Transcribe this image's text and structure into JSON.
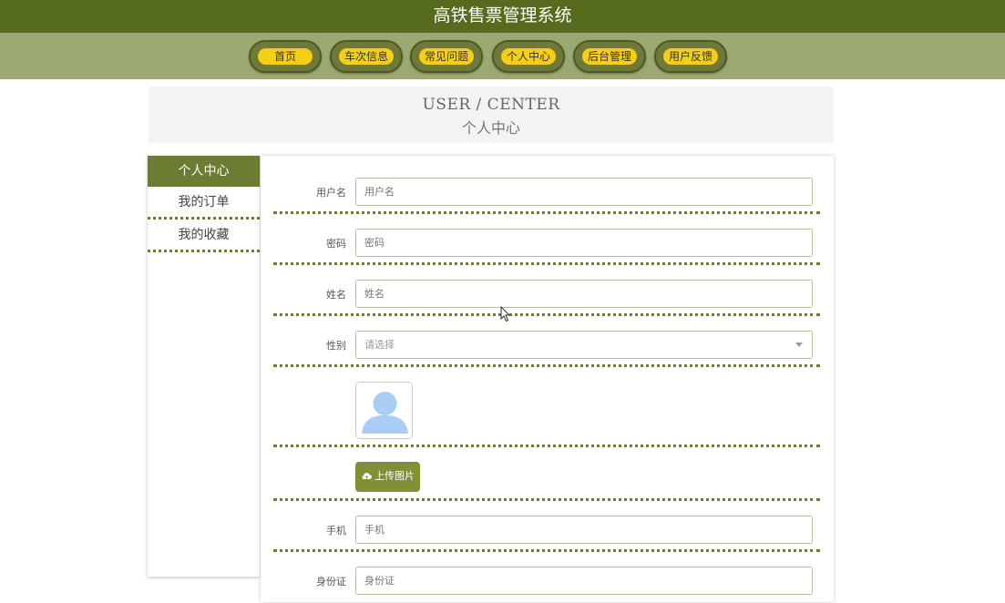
{
  "app": {
    "title": "高铁售票管理系统"
  },
  "nav": [
    {
      "label": "首页"
    },
    {
      "label": "车次信息"
    },
    {
      "label": "常见问题"
    },
    {
      "label": "个人中心"
    },
    {
      "label": "后台管理"
    },
    {
      "label": "用户反馈"
    }
  ],
  "banner": {
    "en": "USER / CENTER",
    "cn": "个人中心"
  },
  "sidebar": {
    "title": "个人中心",
    "items": [
      {
        "label": "我的订单"
      },
      {
        "label": "我的收藏"
      }
    ]
  },
  "form": {
    "username": {
      "label": "用户名",
      "placeholder": "用户名"
    },
    "password": {
      "label": "密码",
      "placeholder": "密码"
    },
    "name": {
      "label": "姓名",
      "placeholder": "姓名"
    },
    "gender": {
      "label": "性别",
      "value": "请选择"
    },
    "upload": {
      "label": "上传图片",
      "icon": "cloud-upload-icon"
    },
    "phone": {
      "label": "手机",
      "placeholder": "手机"
    },
    "idcard": {
      "label": "身份证",
      "placeholder": "身份证"
    }
  },
  "colors": {
    "topbar": "#566b1d",
    "navbar": "#9aa974",
    "nav_pill": "#f5cf16",
    "accent": "#6d7c33",
    "button": "#828f35"
  }
}
